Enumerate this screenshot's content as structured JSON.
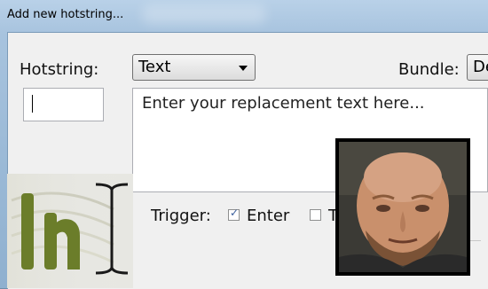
{
  "window": {
    "title": "Add new hotstring..."
  },
  "form": {
    "hotstring_label": "Hotstring:",
    "type_select_value": "Text",
    "bundle_label": "Bundle:",
    "bundle_select_value": "De",
    "hotstring_value": "",
    "replacement_placeholder": "Enter your replacement text here...",
    "trigger_label": "Trigger:",
    "trigger_options": [
      {
        "label": "Enter",
        "checked": true
      },
      {
        "label": "T",
        "checked": false
      }
    ]
  },
  "logo": {
    "text": "lh"
  },
  "colors": {
    "accent": "#3a5e9c",
    "logo_green": "#6b7d2a"
  }
}
